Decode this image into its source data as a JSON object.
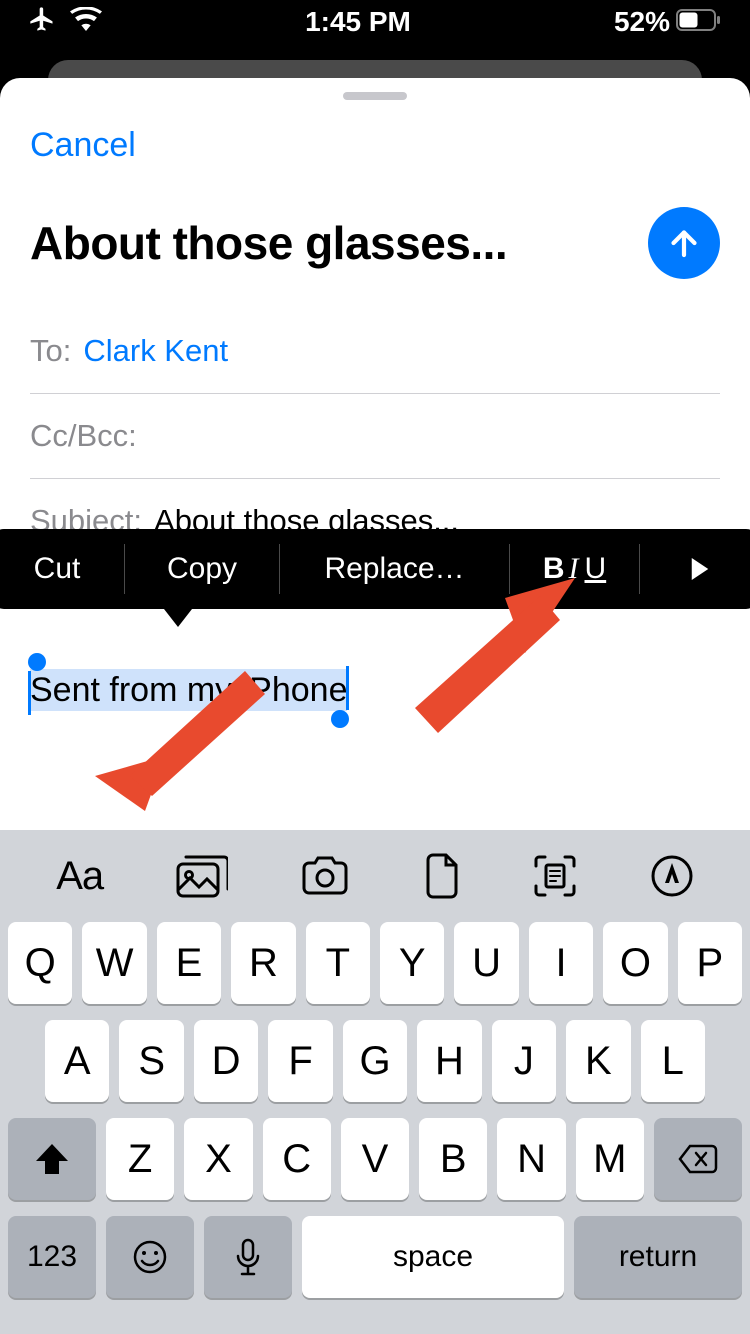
{
  "status": {
    "time": "1:45 PM",
    "battery": "52%"
  },
  "compose": {
    "cancel": "Cancel",
    "subject_display": "About those glasses...",
    "to_label": "To:",
    "to_value": "Clark Kent",
    "cc_label": "Cc/Bcc:",
    "subject_label": "Subject:",
    "subject_value": "About those glasses...",
    "body_selected": "Sent from my iPhone"
  },
  "context_menu": {
    "cut": "Cut",
    "copy": "Copy",
    "replace": "Replace…",
    "biu_b": "B",
    "biu_i": "I",
    "biu_u": "U"
  },
  "kb_toolbar": {
    "aa": "Aa"
  },
  "keyboard": {
    "row1": [
      "Q",
      "W",
      "E",
      "R",
      "T",
      "Y",
      "U",
      "I",
      "O",
      "P"
    ],
    "row2": [
      "A",
      "S",
      "D",
      "F",
      "G",
      "H",
      "J",
      "K",
      "L"
    ],
    "row3": [
      "Z",
      "X",
      "C",
      "V",
      "B",
      "N",
      "M"
    ],
    "num": "123",
    "space": "space",
    "return": "return"
  }
}
